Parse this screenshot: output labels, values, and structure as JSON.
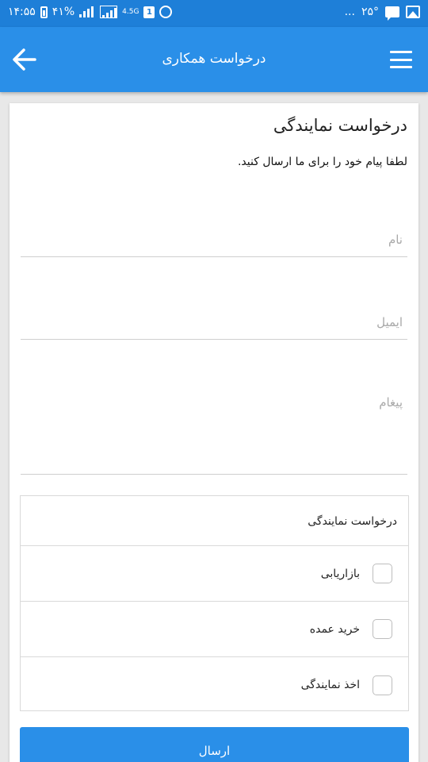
{
  "status": {
    "time": "۱۴:۵۵",
    "battery": "۴۱%",
    "network": "4.5G",
    "sim": "1",
    "temperature": "۲۵°",
    "more": "..."
  },
  "appbar": {
    "title": "درخواست همکاری",
    "back_icon": "arrow-left-icon",
    "menu_icon": "hamburger-menu-icon"
  },
  "form": {
    "title": "درخواست نمایندگی",
    "subtitle": "لطفا پیام خود را برای ما ارسال کنید.",
    "name_placeholder": "نام",
    "email_placeholder": "ایمیل",
    "message_placeholder": "پیغام",
    "group_label": "درخواست نمایندگی",
    "options": [
      {
        "label": "بازاریابی",
        "checked": false
      },
      {
        "label": "خرید عمده",
        "checked": false
      },
      {
        "label": "اخذ نمایندگی",
        "checked": false
      }
    ],
    "submit_label": "ارسال"
  },
  "colors": {
    "statusbar": "#1e7fd8",
    "appbar": "#2a8fe8",
    "accent": "#2a8fe8"
  }
}
